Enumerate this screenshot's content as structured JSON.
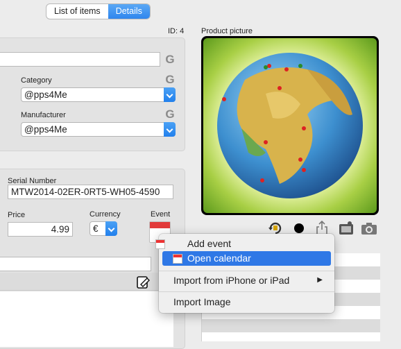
{
  "tabs": [
    {
      "label": "List of items",
      "active": false
    },
    {
      "label": "Details",
      "active": true
    }
  ],
  "id_label": "ID: 4",
  "product_picture_label": "Product picture",
  "category": {
    "label": "Category",
    "value": "@pps4Me"
  },
  "manufacturer": {
    "label": "Manufacturer",
    "value": "@pps4Me"
  },
  "serial": {
    "label": "Serial Number",
    "value": "MTW2014-02ER-0RT5-WH05-4590"
  },
  "price": {
    "label": "Price",
    "value": "4.99"
  },
  "currency": {
    "label": "Currency",
    "value": "€"
  },
  "event": {
    "label": "Event"
  },
  "google_icon_glyph": "G",
  "picture_icons": [
    "rotate-icon",
    "color-dot-icon",
    "share-icon",
    "photo-library-icon",
    "camera-icon"
  ],
  "context_menu": {
    "items": [
      {
        "label": "Add event",
        "icon": "calendar-icon",
        "highlighted": false
      },
      {
        "label": "Open calendar",
        "icon": "calendar-icon",
        "highlighted": true
      },
      {
        "label": "Import from iPhone or iPad",
        "submenu": true
      },
      {
        "label": "Import Image"
      }
    ],
    "submenu_arrow": "▶"
  },
  "colors": {
    "accent": "#2f78e6",
    "segment_active": "#3b8ef0",
    "background": "#ececec"
  }
}
